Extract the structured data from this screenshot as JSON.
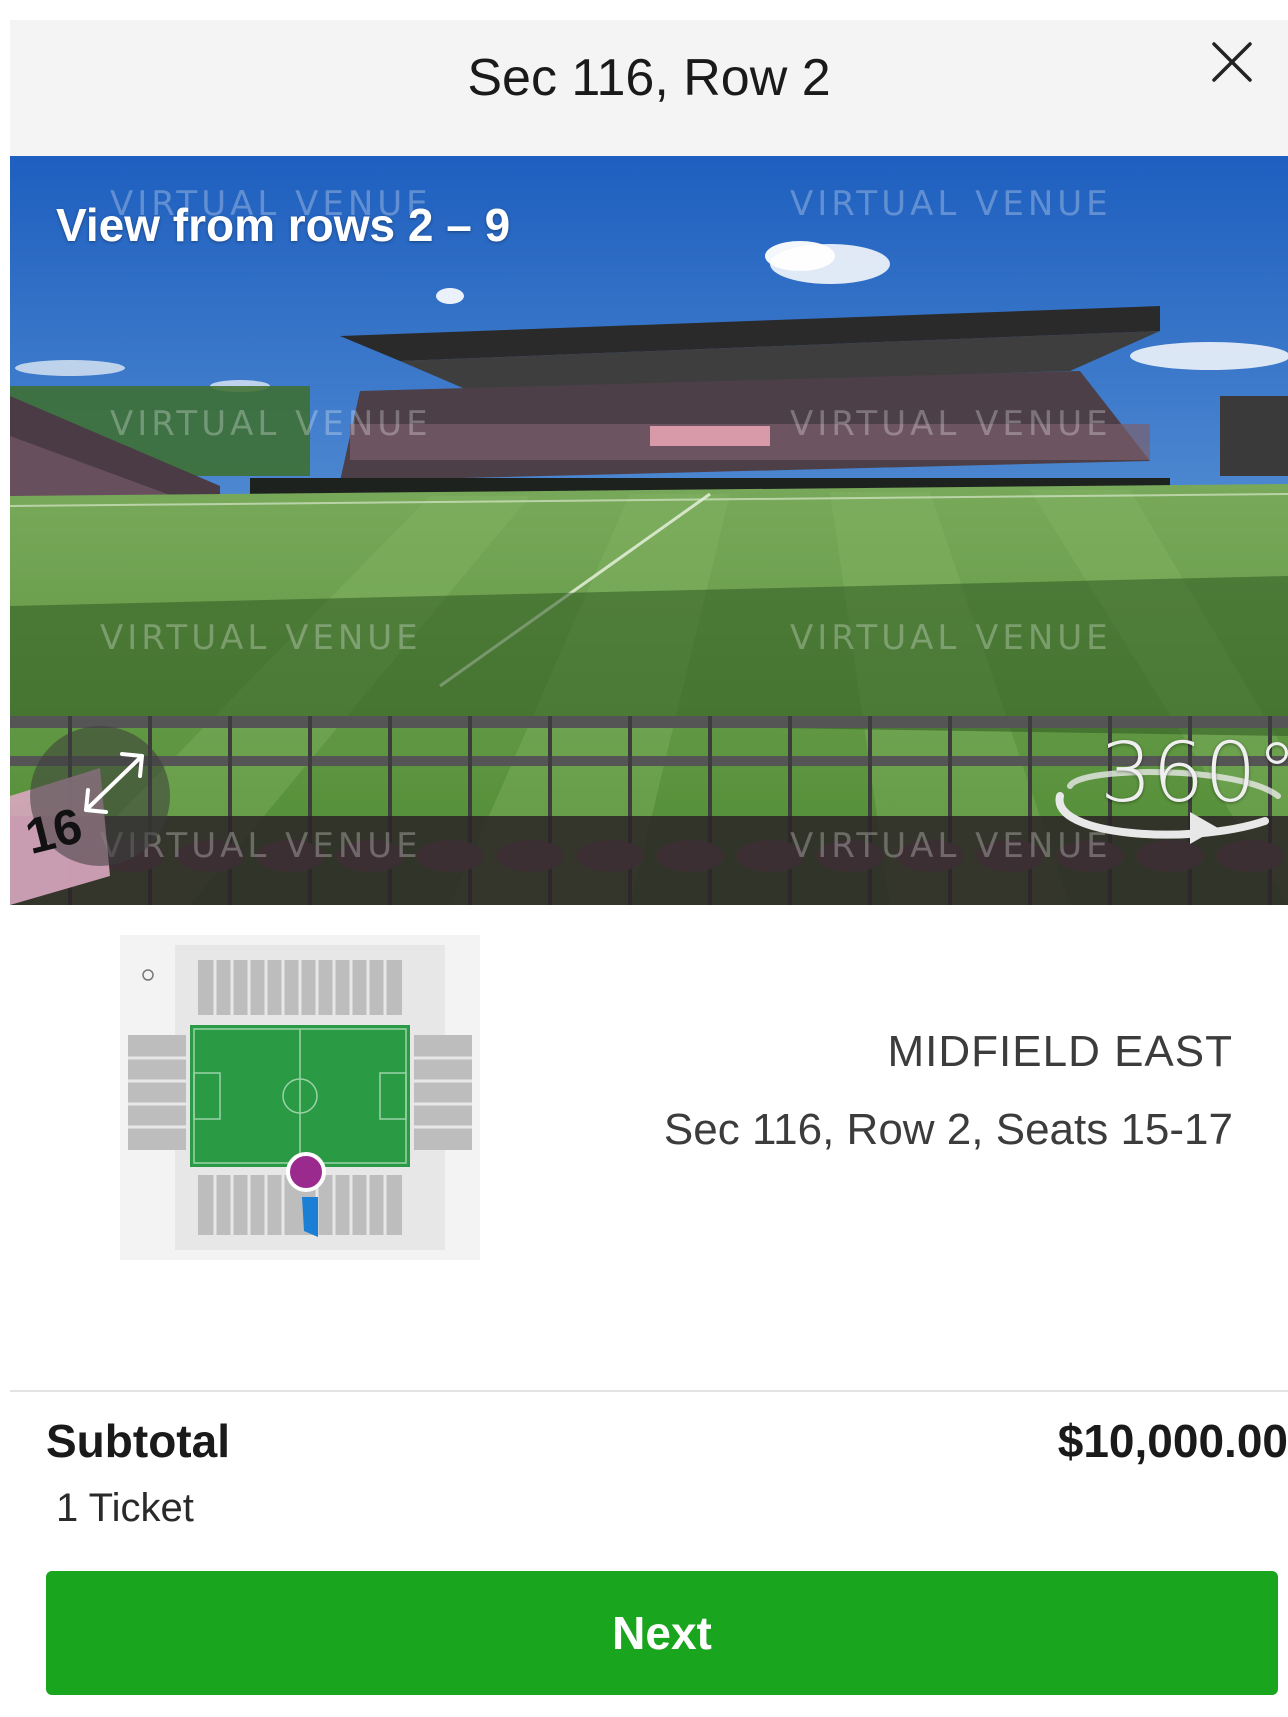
{
  "header": {
    "title": "Sec 116, Row 2"
  },
  "hero": {
    "caption": "View from rows 2 – 9",
    "watermark": "VIRTUAL VENUE",
    "badge_360": "360°",
    "section_tag": "16"
  },
  "details": {
    "zone": "MIDFIELD EAST",
    "seats": "Sec 116, Row 2, Seats 15-17"
  },
  "summary": {
    "label": "Subtotal",
    "price": "$10,000.00",
    "count": "1 Ticket"
  },
  "actions": {
    "next_label": "Next"
  },
  "colors": {
    "accent_green": "#1aa51f",
    "pitch_green": "#2a9a45",
    "marker_purple": "#9b2a8f",
    "marker_blue": "#1c7fd6"
  }
}
